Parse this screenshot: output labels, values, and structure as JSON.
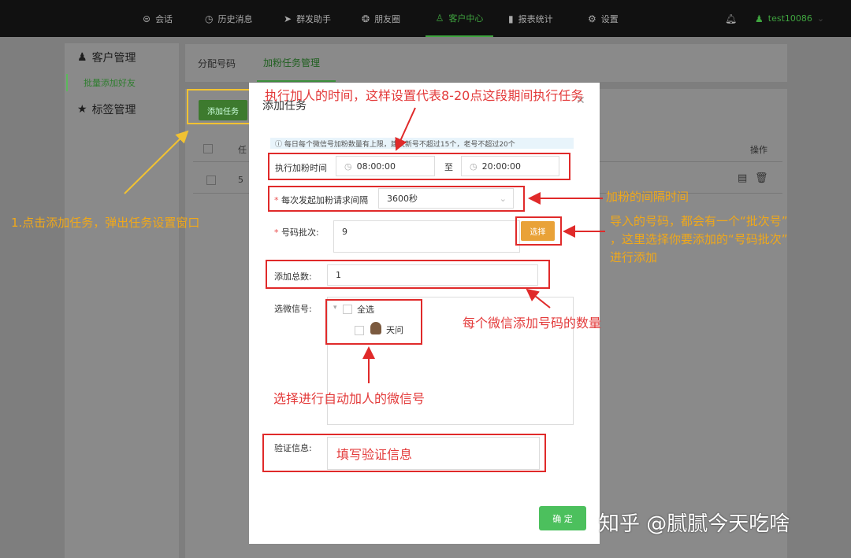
{
  "nav": {
    "items": [
      {
        "label": "会话",
        "icon": "chat-icon"
      },
      {
        "label": "历史消息",
        "icon": "clock-icon"
      },
      {
        "label": "群发助手",
        "icon": "send-icon"
      },
      {
        "label": "朋友圈",
        "icon": "moments-icon"
      },
      {
        "label": "客户中心",
        "icon": "user-icon",
        "active": true
      },
      {
        "label": "报表统计",
        "icon": "bar-chart-icon"
      },
      {
        "label": "设置",
        "icon": "gear-icon"
      }
    ],
    "user": "test10086"
  },
  "sidebar": {
    "customer_management": "客户管理",
    "bulk_add": "批量添加好友",
    "tag_management": "标签管理"
  },
  "tabs": [
    "分配号码",
    "加粉任务管理"
  ],
  "toolbar": {
    "add_task": "添加任务"
  },
  "table": {
    "col_task": "任",
    "col_ops": "操作",
    "row1_id": "5"
  },
  "modal": {
    "title": "添加任务",
    "info": "ⓘ 每日每个微信号加粉数量有上限，建议新号不超过15个，老号不超过20个",
    "exec_time_label": "执行加粉时间",
    "time_start": "08:00:00",
    "time_to": "至",
    "time_end": "20:00:00",
    "interval_label": "每次发起加粉请求间隔",
    "interval_value": "3600秒",
    "batch_label": "号码批次:",
    "batch_value": "9",
    "select_button": "选择",
    "total_label": "添加总数:",
    "total_value": "1",
    "wechat_label": "选微信号:",
    "select_all": "全选",
    "wechat_account": "天问",
    "verify_label": "验证信息:",
    "confirm": "确 定"
  },
  "annotations": {
    "exec_time": "执行加人的时间，这样设置代表8-20点这段期间执行任务",
    "add_task": "1.点击添加任务，弹出任务设置窗口",
    "interval": "加粉的间隔时间",
    "batch_line1": "导入的号码，都会有一个“批次号”",
    "batch_line2": "，这里选择你要添加的“号码批次”",
    "batch_line3": "进行添加",
    "total": "每个微信添加号码的数量",
    "wechat": "选择进行自动加人的微信号",
    "verify": "填写验证信息"
  },
  "watermark": "知乎 @腻腻今天吃啥",
  "colors": {
    "accent": "#3fa43f",
    "annotation_red": "#e02a2a",
    "annotation_yellow": "#f1c232",
    "select_button": "#e9a238",
    "confirm_button": "#4cc05d"
  }
}
